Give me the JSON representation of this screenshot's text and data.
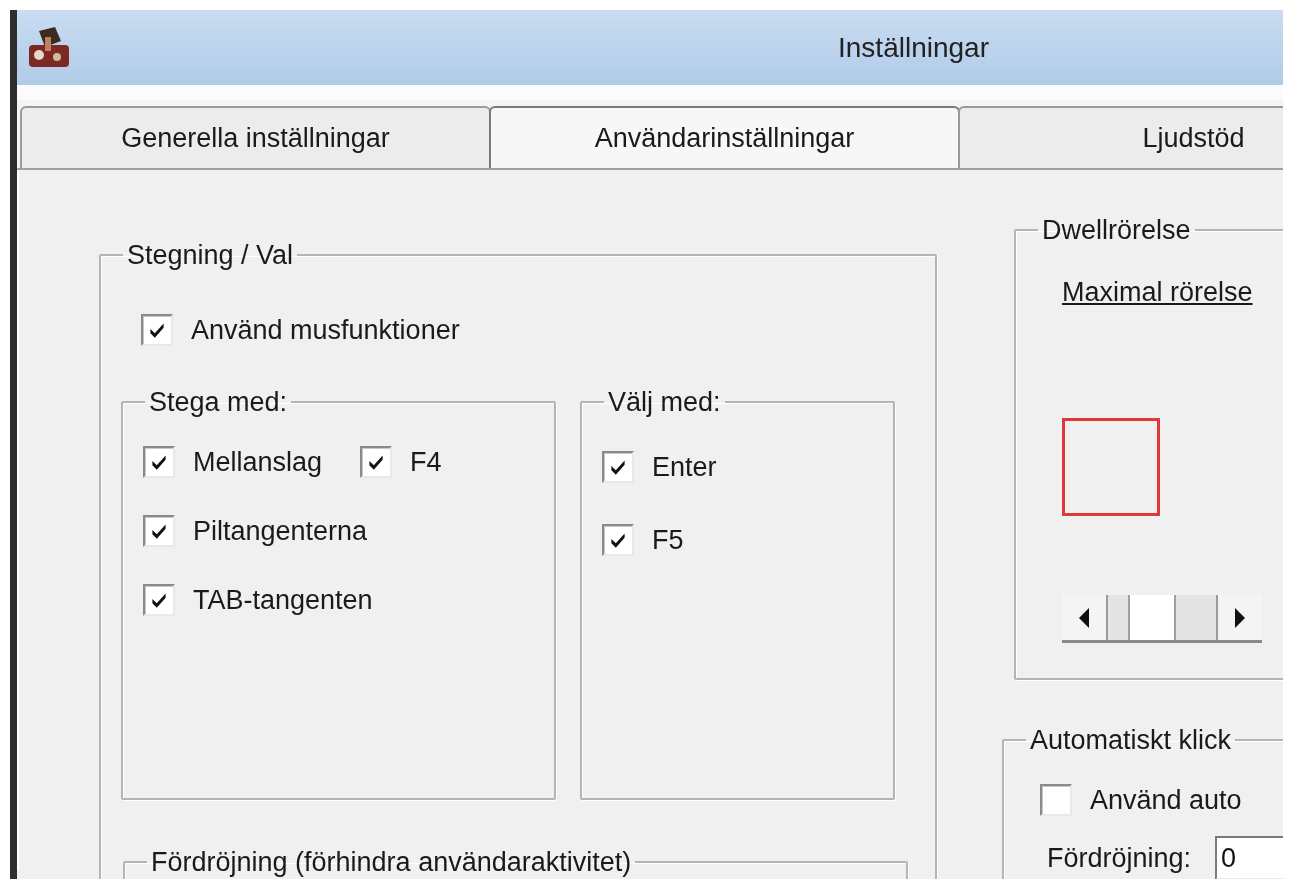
{
  "window": {
    "title": "Inställningar"
  },
  "tabs": [
    {
      "label": "Generella inställningar",
      "selected": false
    },
    {
      "label": "Användarinställningar",
      "selected": true
    },
    {
      "label": "Ljudstöd",
      "selected": false
    }
  ],
  "stepping_group": {
    "title": "Stegning / Val",
    "use_mouse": {
      "label": "Använd musfunktioner",
      "checked": true
    },
    "step_with": {
      "title": "Stega med:",
      "rows": [
        [
          {
            "label": "Mellanslag",
            "checked": true
          },
          {
            "label": "F4",
            "checked": true
          }
        ],
        [
          {
            "label": "Piltangenterna",
            "checked": true
          }
        ],
        [
          {
            "label": "TAB-tangenten",
            "checked": true
          }
        ]
      ]
    },
    "select_with": {
      "title": "Välj med:",
      "rows": [
        [
          {
            "label": "Enter",
            "checked": true
          }
        ],
        [
          {
            "label": "F5",
            "checked": true
          }
        ]
      ]
    }
  },
  "delay_group": {
    "title": "Fördröjning (förhindra användaraktivitet)"
  },
  "dwell_group": {
    "title": "Dwellrörelse",
    "max_movement_label": "Maximal rörelse"
  },
  "auto_click_group": {
    "title": "Automatiskt klick",
    "use_auto": {
      "label": "Använd auto",
      "checked": false
    },
    "delay_label": "Fördröjning:",
    "delay_value": "0"
  }
}
